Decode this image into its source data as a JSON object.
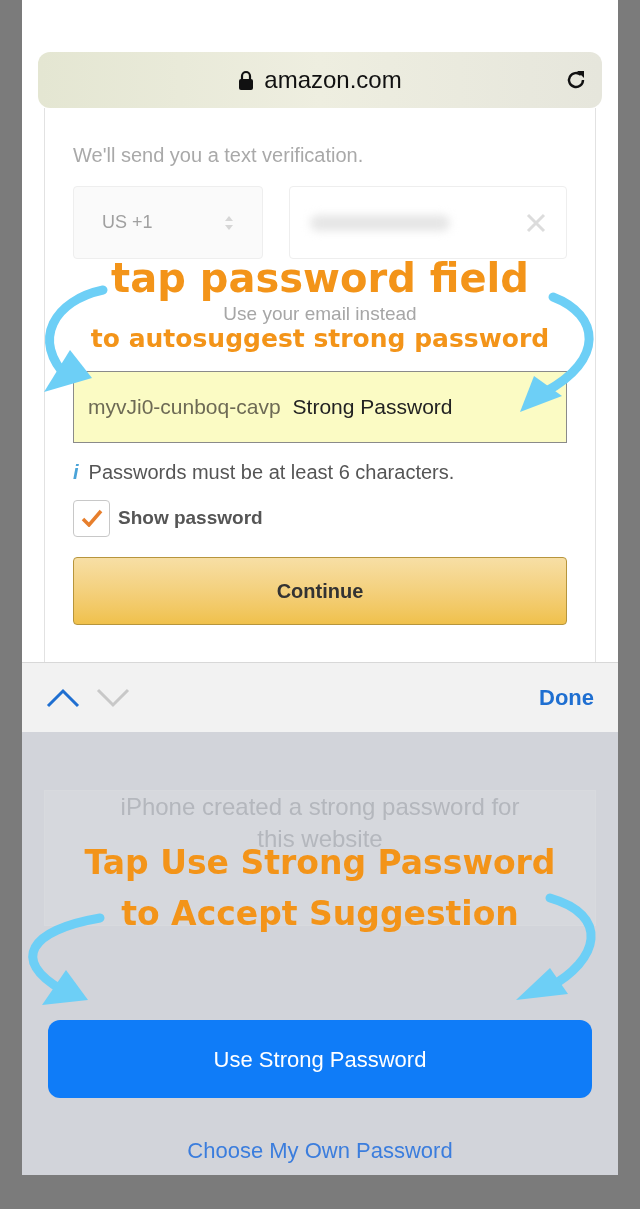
{
  "browser": {
    "address": "amazon.com"
  },
  "form": {
    "sms_note": "We'll send you a text verification.",
    "country_code": "US +1",
    "email_link": "Use your email instead",
    "password": {
      "value": "myvJi0-cunboq-cavp",
      "suggestion_label": "Strong Password"
    },
    "hint_icon": "i",
    "hint": "Passwords must be at least 6 characters.",
    "show_password": {
      "label": "Show password",
      "checked": true
    },
    "continue_button": "Continue"
  },
  "accessory_bar": {
    "previous_enabled": true,
    "next_enabled": false,
    "done": "Done"
  },
  "sheet": {
    "title": "iPhone created a strong password for this website",
    "use_button": "Use Strong Password",
    "own_button": "Choose My Own Password"
  },
  "annotations": [
    {
      "kind": "heading",
      "text": "tap password field"
    },
    {
      "kind": "subheading",
      "text": "to autosuggest strong password"
    },
    {
      "kind": "callout",
      "text": "Tap Use Strong Password"
    },
    {
      "kind": "callout",
      "text": "to Accept Suggestion"
    }
  ]
}
